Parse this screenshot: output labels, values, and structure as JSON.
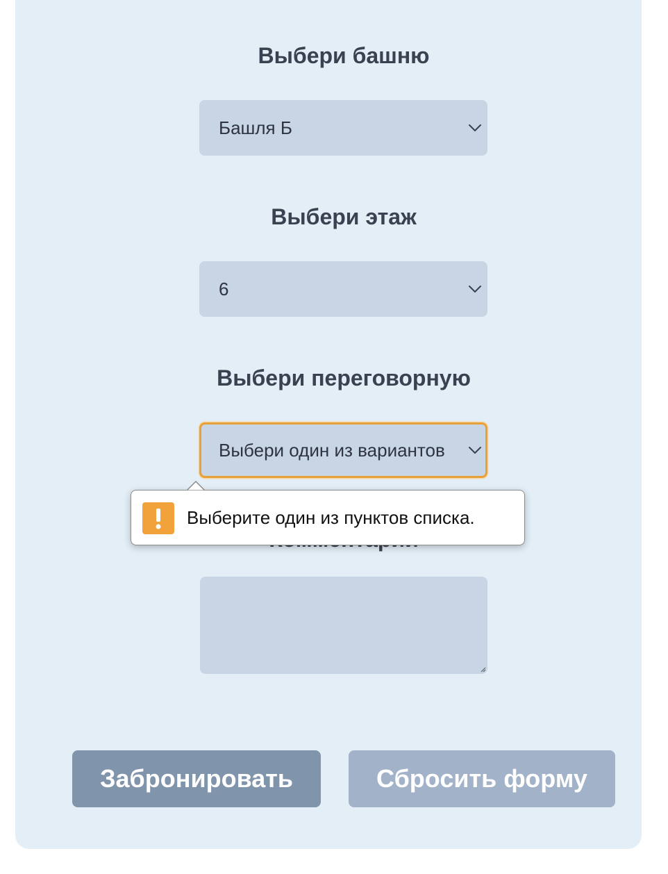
{
  "form": {
    "tower": {
      "label": "Выбери башню",
      "selected": "Башля Б"
    },
    "floor": {
      "label": "Выбери этаж",
      "selected": "6"
    },
    "room": {
      "label": "Выбери переговорную",
      "selected": "Выбери один из вариантов"
    },
    "comment": {
      "label": "Комментарий",
      "value": ""
    },
    "validation_tooltip": {
      "message": "Выберите один из пунктов списка.",
      "icon": "warning-icon"
    },
    "buttons": {
      "submit_label": "Забронировать",
      "reset_label": "Сбросить форму"
    }
  },
  "colors": {
    "card_background": "#e3eef6",
    "field_background": "#c7d5e5",
    "focus_border": "#e8a039",
    "warning_icon": "#f2a23b",
    "submit_button": "#8094ab",
    "reset_button": "#a2b3c9",
    "label_text": "#3a4150"
  }
}
